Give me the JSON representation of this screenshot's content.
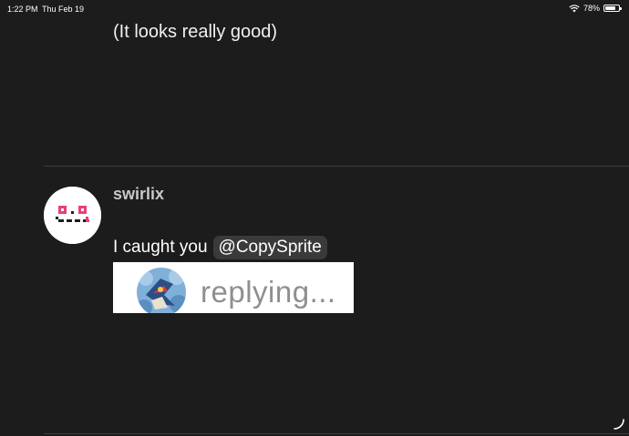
{
  "status_bar": {
    "time": "1:22 PM",
    "date": "Thu Feb 19",
    "battery_percent": "78%",
    "battery_level": 0.78
  },
  "previous_post": {
    "text": "(It looks really good)"
  },
  "post": {
    "username": "swirlix",
    "body_text": "I caught you",
    "mention": "@CopySprite",
    "image_text": "replying..."
  },
  "colors": {
    "background": "#1c1c1c",
    "divider": "#3e3e3e",
    "mention_bg": "#3a3a3a",
    "username": "#c8c8c8",
    "avatar_accent": "#e8407a"
  }
}
